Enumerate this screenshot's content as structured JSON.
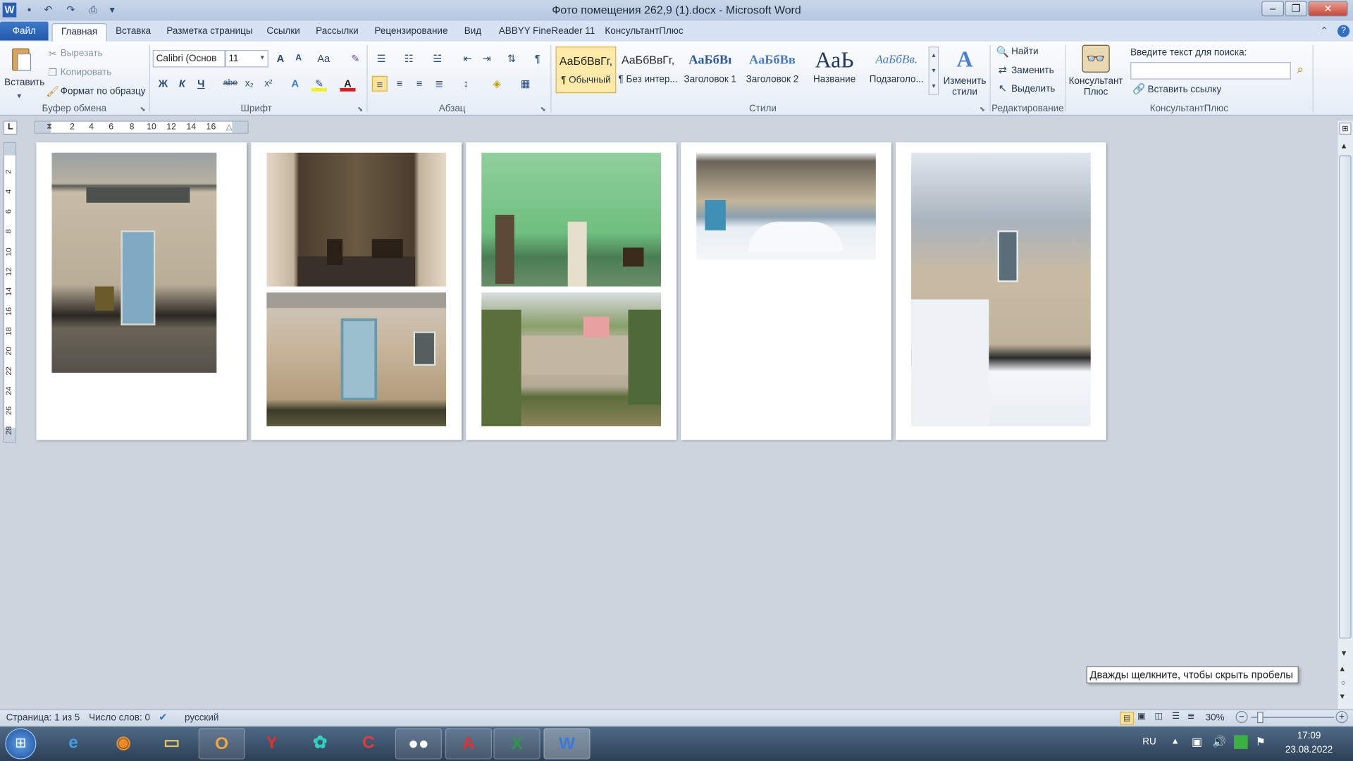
{
  "window": {
    "title": "Фото помещения 262,9 (1).docx - Microsoft Word",
    "app_icon": "W"
  },
  "tabs": [
    "Файл",
    "Главная",
    "Вставка",
    "Разметка страницы",
    "Ссылки",
    "Рассылки",
    "Рецензирование",
    "Вид",
    "ABBYY FineReader 11",
    "КонсультантПлюс"
  ],
  "ribbon": {
    "clipboard": {
      "label": "Буфер обмена",
      "paste": "Вставить",
      "cut": "Вырезать",
      "copy": "Копировать",
      "format_painter": "Формат по образцу"
    },
    "font": {
      "label": "Шрифт",
      "name": "Calibri (Основ",
      "size": "11",
      "bold": "Ж",
      "italic": "К",
      "underline": "Ч",
      "strike": "abe",
      "sub": "x₂",
      "sup": "x²",
      "case": "Aa",
      "grow": "A",
      "shrink": "A"
    },
    "paragraph": {
      "label": "Абзац",
      "pilcrow": "¶"
    },
    "styles": {
      "label": "Стили",
      "change": "Изменить стили",
      "items": [
        {
          "sample": "АаБбВвГг,",
          "name": "¶ Обычный"
        },
        {
          "sample": "АаБбВвГг,",
          "name": "¶ Без интер..."
        },
        {
          "sample": "АаБбВı",
          "name": "Заголовок 1"
        },
        {
          "sample": "АаБбВв",
          "name": "Заголовок 2"
        },
        {
          "sample": "АаЬ",
          "name": "Название"
        },
        {
          "sample": "АаБбВв.",
          "name": "Подзаголо..."
        }
      ]
    },
    "editing": {
      "label": "Редактирование",
      "find": "Найти",
      "replace": "Заменить",
      "select": "Выделить"
    },
    "consultant": {
      "label": "КонсультантПлюс",
      "button": "Консультант Плюс",
      "search_label": "Введите текст для поиска:",
      "search_value": "",
      "insert_link": "Вставить ссылку"
    }
  },
  "ruler": {
    "h_ticks": [
      "2",
      "4",
      "6",
      "8",
      "10",
      "12",
      "14",
      "16"
    ],
    "v_ticks": [
      "2",
      "4",
      "6",
      "8",
      "10",
      "12",
      "14",
      "16",
      "18",
      "20",
      "22",
      "24",
      "26",
      "28"
    ]
  },
  "tooltip": "Дважды щелкните, чтобы скрыть пробелы",
  "status": {
    "page": "Страница: 1 из 5",
    "words": "Число слов: 0",
    "language": "русский",
    "zoom": "30%"
  },
  "taskbar": {
    "lang": "RU",
    "time": "17:09",
    "date": "23.08.2022"
  }
}
